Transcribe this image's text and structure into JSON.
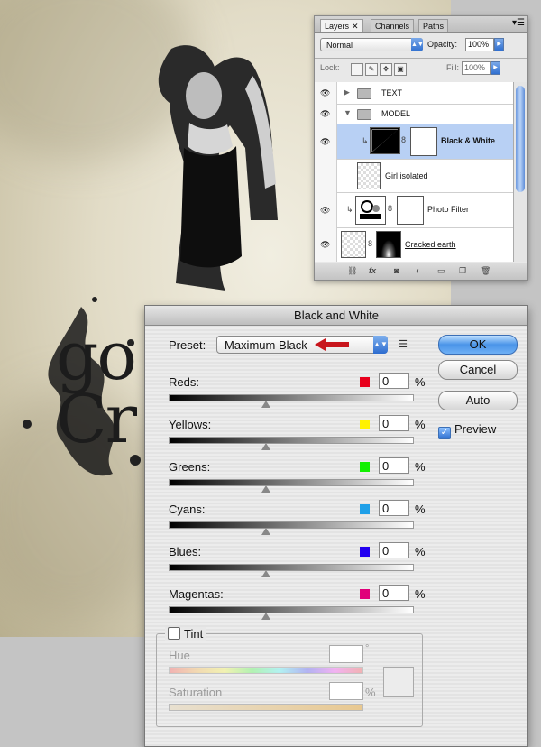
{
  "canvas": {
    "big_text_line1": "go",
    "big_text_line2": "Cr"
  },
  "layers_panel": {
    "tabs": [
      {
        "label": "Layers",
        "close": "✕"
      },
      {
        "label": "Channels"
      },
      {
        "label": "Paths"
      }
    ],
    "blend_mode": "Normal",
    "opacity_label": "Opacity:",
    "opacity_value": "100%",
    "lock_label": "Lock:",
    "fill_label": "Fill:",
    "fill_value": "100%",
    "layers": [
      {
        "name": "TEXT",
        "type": "group",
        "expanded": false
      },
      {
        "name": "MODEL",
        "type": "group",
        "expanded": true
      },
      {
        "name": "Black & White",
        "type": "adjustment",
        "selected": true
      },
      {
        "name": "Girl isolated",
        "type": "pixel"
      },
      {
        "name": "Photo Filter",
        "type": "adjustment"
      },
      {
        "name": "Cracked earth",
        "type": "pixel"
      }
    ],
    "bottom_icons": [
      "link-icon",
      "fx-icon",
      "mask-icon",
      "adjustment-icon",
      "folder-icon",
      "new-layer-icon",
      "trash-icon"
    ],
    "fx_label": "fx"
  },
  "dialog": {
    "title": "Black and White",
    "preset_label": "Preset:",
    "preset_value": "Maximum Black",
    "buttons": {
      "ok": "OK",
      "cancel": "Cancel",
      "auto": "Auto"
    },
    "preview_label": "Preview",
    "preview_checked": true,
    "pct": "%",
    "channels": [
      {
        "label": "Reds:",
        "value": "0",
        "color": "#e8001c"
      },
      {
        "label": "Yellows:",
        "value": "0",
        "color": "#fff200"
      },
      {
        "label": "Greens:",
        "value": "0",
        "color": "#12f000"
      },
      {
        "label": "Cyans:",
        "value": "0",
        "color": "#1fa0e8"
      },
      {
        "label": "Blues:",
        "value": "0",
        "color": "#2200f0"
      },
      {
        "label": "Magentas:",
        "value": "0",
        "color": "#e0007a"
      }
    ],
    "tint": {
      "label": "Tint",
      "checked": false,
      "hue_label": "Hue",
      "hue_unit": "°",
      "saturation_label": "Saturation",
      "saturation_unit": "%"
    }
  }
}
